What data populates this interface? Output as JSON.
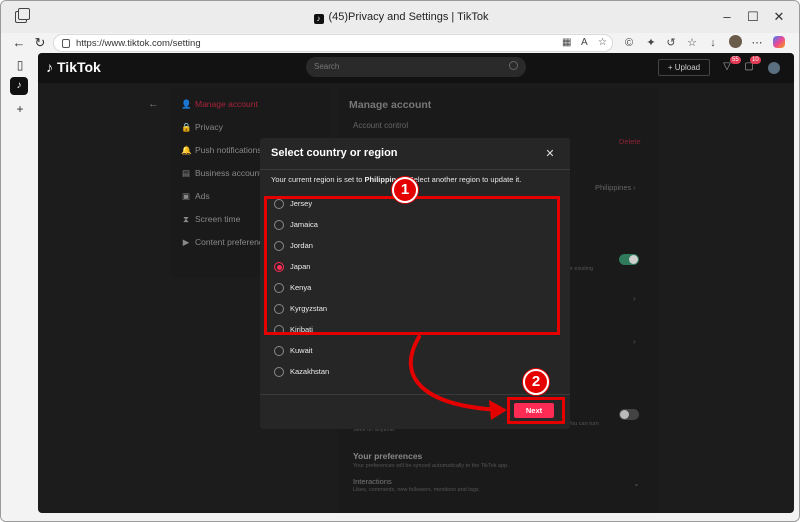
{
  "browser": {
    "tab_title": "(45)Privacy and Settings | TikTok",
    "favicon_glyph": "♪",
    "url": "https://www.tiktok.com/setting"
  },
  "tiktok": {
    "logo": "TikTok",
    "search_placeholder": "Search",
    "upload_label": "+ Upload",
    "inbox_badge": "55",
    "messages_badge": "10"
  },
  "sidebar": {
    "items": [
      {
        "label": "Manage account",
        "icon": "👤"
      },
      {
        "label": "Privacy",
        "icon": "🔒"
      },
      {
        "label": "Push notifications",
        "icon": "🔔"
      },
      {
        "label": "Business account",
        "icon": "▤"
      },
      {
        "label": "Ads",
        "icon": "▣"
      },
      {
        "label": "Screen time",
        "icon": "⧗"
      },
      {
        "label": "Content preferences",
        "icon": "▶"
      }
    ]
  },
  "main": {
    "title": "Manage account",
    "account_control": "Account control",
    "delete_label": "Delete",
    "region_value": "Philippines",
    "existing_text": "or existing",
    "you_can_text": "You can turn",
    "seen_text": "Sees on anytime.",
    "preferences_title": "Your preferences",
    "preferences_sub": "Your preferences will be synced automatically to the TikTok app.",
    "interactions_label": "Interactions",
    "interactions_sub": "Likes, comments, new followers, mentions and tags"
  },
  "modal": {
    "title": "Select country or region",
    "note_prefix": "Your current region is set to ",
    "note_region": "Philippines",
    "note_suffix": ". Select another region to update it.",
    "countries": [
      {
        "label": "Jersey",
        "selected": false
      },
      {
        "label": "Jamaica",
        "selected": false
      },
      {
        "label": "Jordan",
        "selected": false
      },
      {
        "label": "Japan",
        "selected": true
      },
      {
        "label": "Kenya",
        "selected": false
      },
      {
        "label": "Kyrgyzstan",
        "selected": false
      },
      {
        "label": "Kiribati",
        "selected": false
      },
      {
        "label": "Kuwait",
        "selected": false
      },
      {
        "label": "Kazakhstan",
        "selected": false
      }
    ],
    "next_label": "Next",
    "close_glyph": "✕"
  },
  "annotations": {
    "step1": "1",
    "step2": "2",
    "color": "#e50000"
  },
  "colors": {
    "accent": "#fe2c55",
    "modal_bg": "#262626"
  }
}
